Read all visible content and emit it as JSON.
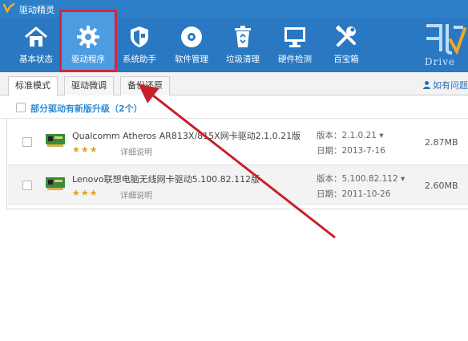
{
  "window": {
    "title": "驱动精灵"
  },
  "toolbar": {
    "items": [
      {
        "label": "基本状态",
        "icon": "home-icon"
      },
      {
        "label": "驱动程序",
        "icon": "gear-icon",
        "active": true
      },
      {
        "label": "系统助手",
        "icon": "shield-icon"
      },
      {
        "label": "软件管理",
        "icon": "disc-icon"
      },
      {
        "label": "垃圾清理",
        "icon": "recycle-bin-icon"
      },
      {
        "label": "硬件检测",
        "icon": "monitor-icon"
      },
      {
        "label": "百宝箱",
        "icon": "tools-icon"
      }
    ],
    "brand_drive": "Drive"
  },
  "tabs": [
    {
      "label": "标准模式",
      "active": true
    },
    {
      "label": "驱动微调",
      "active": false
    },
    {
      "label": "备份还原",
      "active": false
    }
  ],
  "help": {
    "label": "如有问题"
  },
  "section": {
    "label": "部分驱动有新版升级（2个）"
  },
  "drivers": [
    {
      "name": "Qualcomm Atheros AR813X/815X网卡驱动2.1.0.21版",
      "stars": "★★★",
      "detail": "详细说明",
      "version": "版本：2.1.0.21 ▾",
      "date": "日期：2013-7-16",
      "size": "2.87MB"
    },
    {
      "name": "Lenovo联想电脑无线网卡驱动5.100.82.112版",
      "stars": "★★★",
      "detail": "详细说明",
      "version": "版本：5.100.82.112 ▾",
      "date": "日期：2011-10-26",
      "size": "2.60MB"
    }
  ],
  "colors": {
    "toolbar": "#2a78c2",
    "highlight_frame": "#d8243c",
    "annotation_arrow": "#c8202c",
    "section_text": "#2f8bd6"
  }
}
